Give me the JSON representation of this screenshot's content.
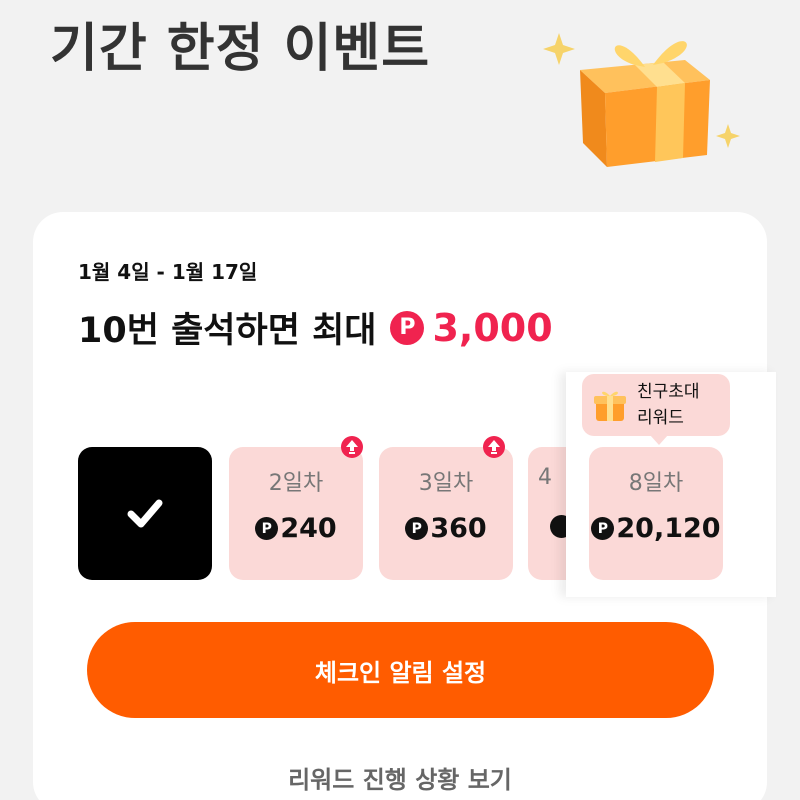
{
  "header": {
    "title": "기간 한정 이벤트",
    "hero_icon": "gift-box-icon"
  },
  "event": {
    "date_range": "1월 4일 - 1월 17일",
    "headline_prefix": "10번 출석하면 최대",
    "point_symbol": "P",
    "max_reward": "3,000"
  },
  "days": [
    {
      "label": "",
      "reward": "",
      "checked": true
    },
    {
      "label": "2일차",
      "reward": "240",
      "checked": false,
      "boosted": true
    },
    {
      "label": "3일차",
      "reward": "360",
      "checked": false,
      "boosted": true
    },
    {
      "label": "8일차",
      "reward": "20,120",
      "checked": false,
      "highlighted": true
    }
  ],
  "peek_label": "4",
  "tooltip": {
    "text_line1": "친구초대",
    "text_line2": "리워드",
    "icon": "mini-gift-icon"
  },
  "actions": {
    "checkin_alarm": "체크인 알림 설정",
    "view_progress": "리워드 진행 상황 보기"
  },
  "colors": {
    "accent_red": "#f0234f",
    "cta_orange": "#ff5c00",
    "day_card_bg": "#fbd9d7"
  }
}
